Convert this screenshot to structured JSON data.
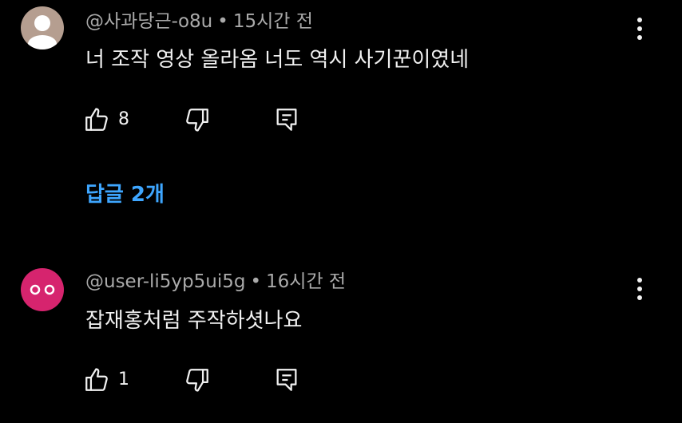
{
  "comments": [
    {
      "author": "@사과당근-o8u",
      "separator": "•",
      "time": "15시간 전",
      "text": "너 조작 영상 올라옴 너도 역시 사기꾼이였네",
      "likes": "8",
      "avatar_color": "#b59e90",
      "avatar_icon": "person-silhouette-icon"
    },
    {
      "author": "@user-li5yp5ui5g",
      "separator": "•",
      "time": "16시간 전",
      "text": "잡재홍처럼 주작하셧나요",
      "likes": "1",
      "avatar_color": "#d6246e",
      "avatar_icon": "two-circles-icon"
    }
  ],
  "replies_label": "답글 2개",
  "colors": {
    "background": "#000000",
    "text": "#f1f1f1",
    "secondary_text": "#aaaaaa",
    "link": "#3ea6ff"
  }
}
